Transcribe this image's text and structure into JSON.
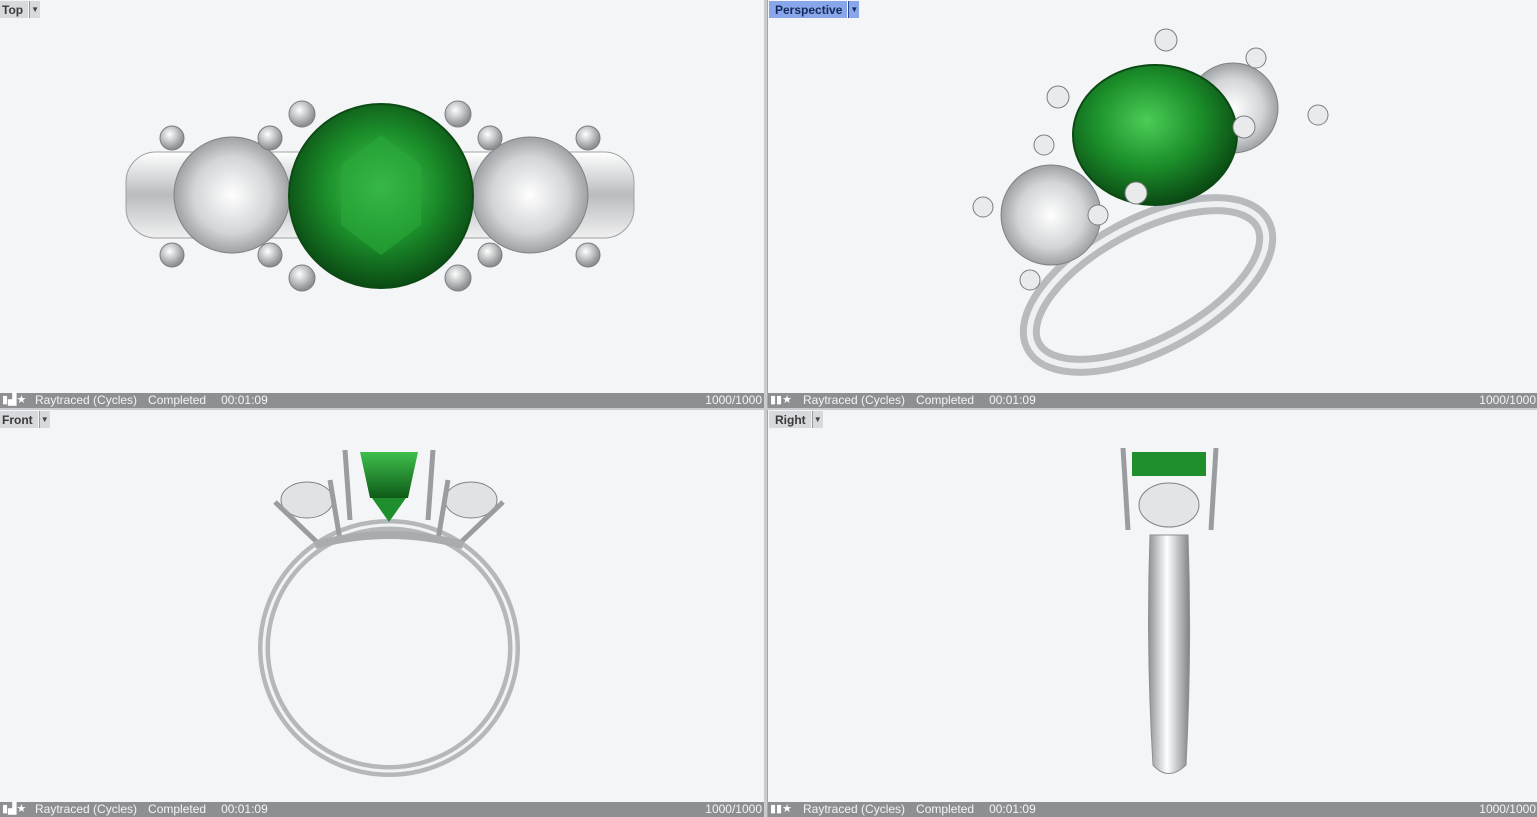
{
  "viewports": {
    "top": {
      "name": "Top",
      "status": {
        "renderer": "Raytraced (Cycles)",
        "state": "Completed",
        "time": "00:01:09",
        "progress": "1000/1000"
      }
    },
    "perspective": {
      "name": "Perspective",
      "status": {
        "renderer": "Raytraced (Cycles)",
        "state": "Completed",
        "time": "00:01:09",
        "progress": "1000/1000"
      }
    },
    "front": {
      "name": "Front",
      "status": {
        "renderer": "Raytraced (Cycles)",
        "state": "Completed",
        "time": "00:01:09",
        "progress": "1000/1000"
      }
    },
    "right": {
      "name": "Right",
      "status": {
        "renderer": "Raytraced (Cycles)",
        "state": "Completed",
        "time": "00:01:09",
        "progress": "1000/1000"
      }
    }
  },
  "active_viewport": "perspective",
  "colors": {
    "viewport_bg": "#f4f5f7",
    "active_tab": "#8aa6ea",
    "statusbar": "#8d8f92",
    "emerald": "#1f8a2e",
    "metal": "#d9dbdd"
  },
  "icons": {
    "tab_dropdown": "chevron-down-icon",
    "status": "render-status-icon"
  }
}
